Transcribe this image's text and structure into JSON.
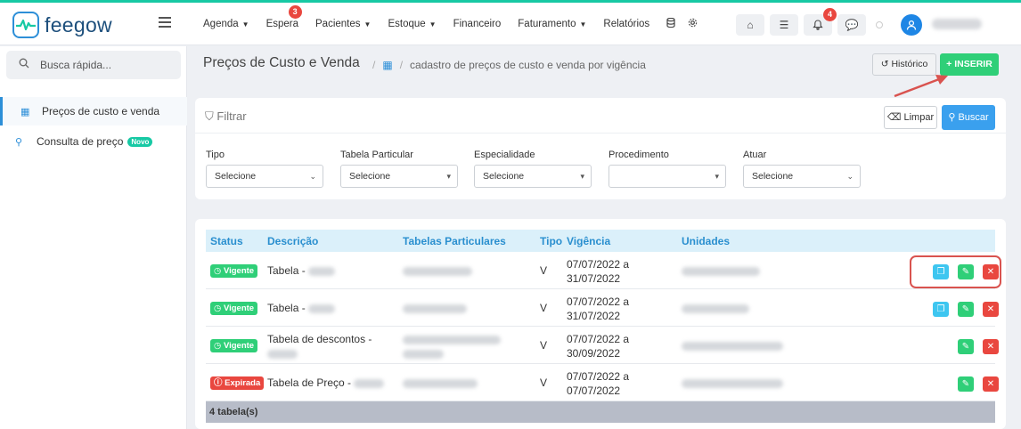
{
  "header": {
    "logo_text": "feegow",
    "nav": [
      {
        "label": "Agenda",
        "caret": true
      },
      {
        "label": "Espera",
        "badge": "3"
      },
      {
        "label": "Pacientes",
        "caret": true
      },
      {
        "label": "Estoque",
        "caret": true
      },
      {
        "label": "Financeiro"
      },
      {
        "label": "Faturamento",
        "caret": true
      },
      {
        "label": "Relatórios"
      }
    ],
    "notif_badge": "4"
  },
  "sidebar": {
    "search_placeholder": "Busca rápida...",
    "items": [
      {
        "label": "Preços de custo e venda",
        "active": true
      },
      {
        "label": "Consulta de preço",
        "tag": "Novo"
      }
    ]
  },
  "page": {
    "title": "Preços de Custo e Venda",
    "breadcrumb": "cadastro de preços de custo e venda por vigência",
    "historico_label": "Histórico",
    "inserir_label": "+ INSERIR"
  },
  "filter": {
    "title": "Filtrar",
    "limpar_label": "Limpar",
    "buscar_label": "Buscar",
    "fields": [
      {
        "label": "Tipo",
        "value": "Selecione"
      },
      {
        "label": "Tabela Particular",
        "value": "Selecione"
      },
      {
        "label": "Especialidade",
        "value": "Selecione"
      },
      {
        "label": "Procedimento",
        "value": ""
      },
      {
        "label": "Atuar",
        "value": "Selecione"
      }
    ]
  },
  "table": {
    "columns": [
      "Status",
      "Descrição",
      "Tabelas Particulares",
      "Tipo",
      "Vigência",
      "Unidades"
    ],
    "rows": [
      {
        "status": "Vigente",
        "status_color": "#2fcf78",
        "descricao": "Tabela -",
        "tipo": "V",
        "vig_start": "07/07/2022 a",
        "vig_end": "31/07/2022",
        "copy": true
      },
      {
        "status": "Vigente",
        "status_color": "#2fcf78",
        "descricao": "Tabela -",
        "tipo": "V",
        "vig_start": "07/07/2022 a",
        "vig_end": "31/07/2022",
        "copy": true
      },
      {
        "status": "Vigente",
        "status_color": "#2fcf78",
        "descricao": "Tabela de descontos -",
        "tipo": "V",
        "vig_start": "07/07/2022 a",
        "vig_end": "30/09/2022",
        "copy": false
      },
      {
        "status": "Expirada",
        "status_color": "#e9473f",
        "descricao": "Tabela de Preço -",
        "tipo": "V",
        "vig_start": "07/07/2022 a",
        "vig_end": "07/07/2022",
        "copy": false
      }
    ],
    "footer": "4 tabela(s)"
  }
}
